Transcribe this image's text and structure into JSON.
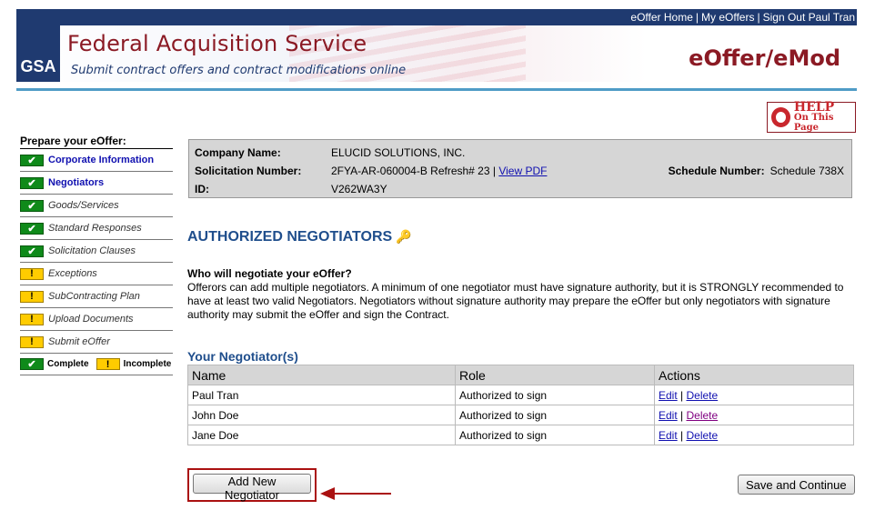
{
  "topnav": {
    "home": "eOffer Home",
    "my_eoffers": "My eOffers",
    "sign_out": "Sign Out Paul Tran"
  },
  "banner": {
    "logo": "GSA",
    "title": "Federal Acquisition Service",
    "subtitle": "Submit contract offers and contract modifications online",
    "app_name": "eOffer/eMod"
  },
  "help": {
    "line1": "HELP",
    "line2": "On This Page"
  },
  "sidebar": {
    "title": "Prepare your eOffer:",
    "items": [
      {
        "label": "Corporate Information",
        "status": "complete",
        "active": true
      },
      {
        "label": "Negotiators",
        "status": "complete",
        "active": true
      },
      {
        "label": "Goods/Services",
        "status": "complete",
        "active": false
      },
      {
        "label": "Standard Responses",
        "status": "complete",
        "active": false
      },
      {
        "label": "Solicitation Clauses",
        "status": "complete",
        "active": false
      },
      {
        "label": "Exceptions",
        "status": "incomplete",
        "active": false
      },
      {
        "label": "SubContracting Plan",
        "status": "incomplete",
        "active": false
      },
      {
        "label": "Upload Documents",
        "status": "incomplete",
        "active": false
      },
      {
        "label": "Submit eOffer",
        "status": "incomplete",
        "active": false
      }
    ],
    "legend": {
      "complete": "Complete",
      "incomplete": "Incomplete"
    }
  },
  "info": {
    "company_label": "Company Name:",
    "company_value": "ELUCID SOLUTIONS, INC.",
    "solicitation_label": "Solicitation Number:",
    "solicitation_value": "2FYA-AR-060004-B Refresh# 23 |",
    "view_pdf": "View PDF",
    "schedule_label": "Schedule Number:",
    "schedule_value": "Schedule 738X",
    "id_label": "ID:",
    "id_value": "V262WA3Y"
  },
  "main": {
    "heading": "AUTHORIZED NEGOTIATORS",
    "question": "Who will negotiate your eOffer?",
    "description": "Offerors can add multiple negotiators. A minimum of one negotiator must have signature authority, but it is STRONGLY recommended to have at least two valid Negotiators. Negotiators without signature authority may prepare the eOffer but only negotiators with signature authority may submit the eOffer and sign the Contract.",
    "table_title": "Your Negotiator(s)",
    "columns": [
      "Name",
      "Role",
      "Actions"
    ],
    "rows": [
      {
        "name": "Paul Tran",
        "role": "Authorized to sign"
      },
      {
        "name": "John Doe",
        "role": "Authorized to sign"
      },
      {
        "name": "Jane Doe",
        "role": "Authorized to sign"
      }
    ],
    "edit_label": "Edit",
    "delete_label": "Delete",
    "add_button": "Add New Negotiator",
    "save_button": "Save and Continue"
  },
  "colors": {
    "navy": "#1f3a70",
    "maroon": "#8b1a24",
    "heading_blue": "#1f4e8c",
    "complete_green": "#0f8a1a",
    "incomplete_yellow": "#ffcc00",
    "highlight_red": "#aa1111"
  }
}
